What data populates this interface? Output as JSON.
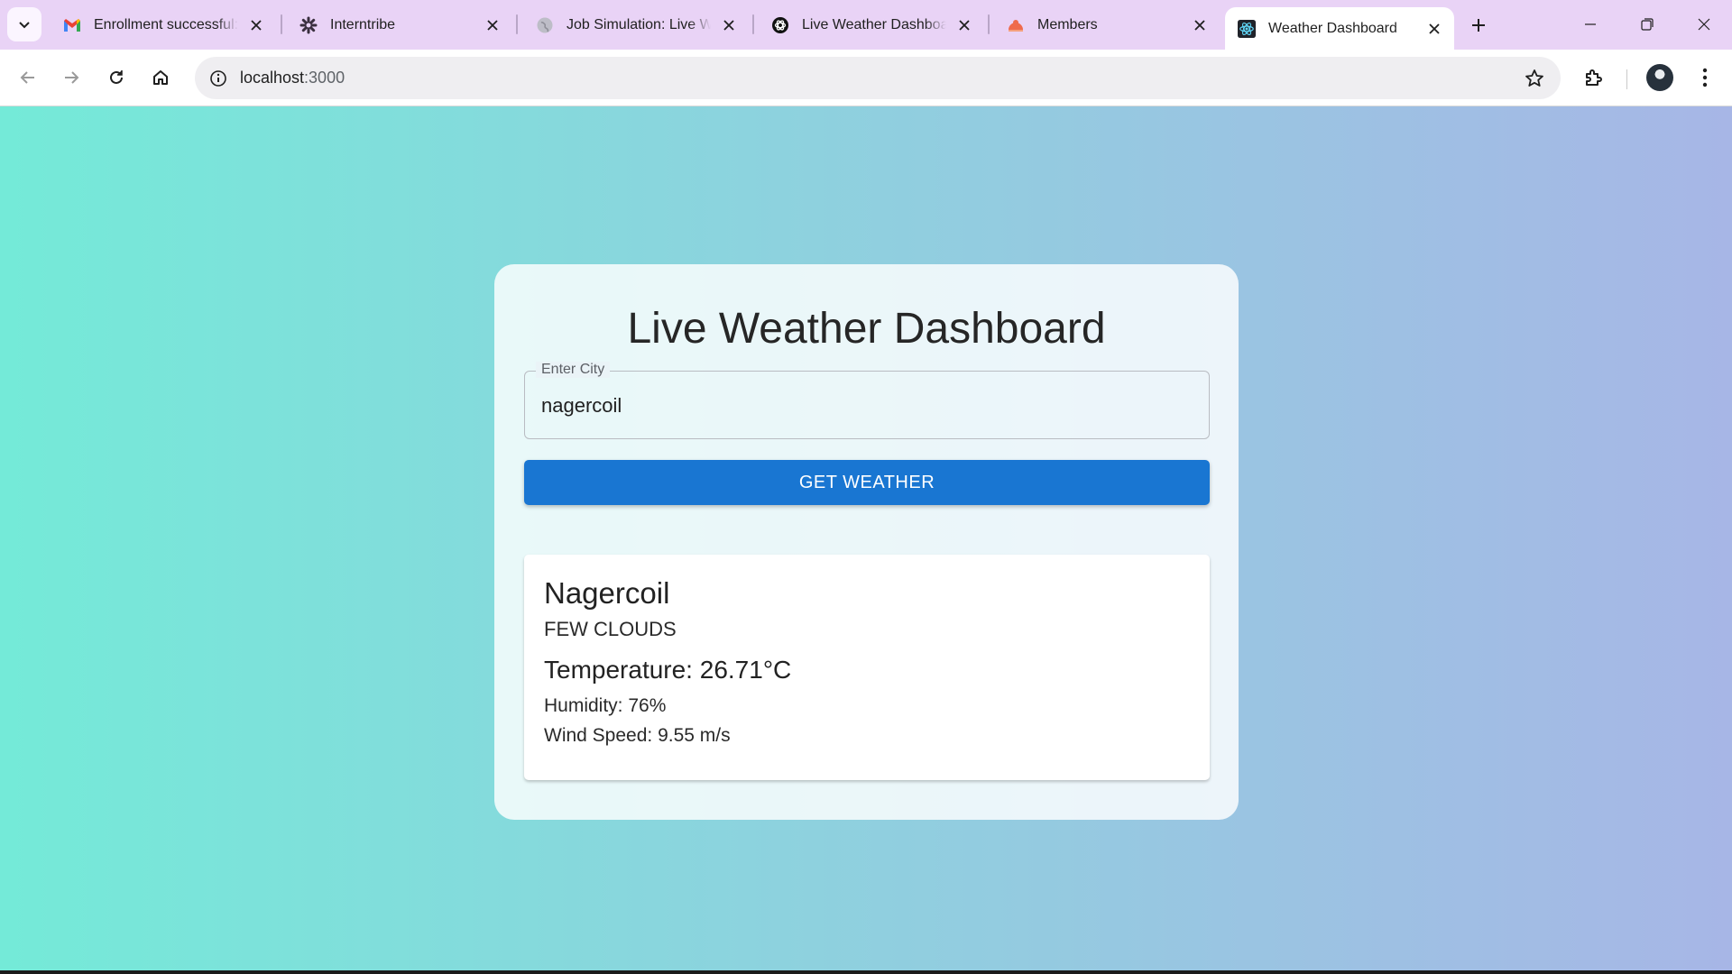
{
  "browser": {
    "tabs": [
      {
        "title": "Enrollment successful: In",
        "icon": "gmail-icon"
      },
      {
        "title": "Interntribe",
        "icon": "interntribe-icon"
      },
      {
        "title": "Job Simulation: Live Wea",
        "icon": "globe-icon"
      },
      {
        "title": "Live Weather Dashboard",
        "icon": "openai-icon"
      },
      {
        "title": "Members",
        "icon": "members-icon"
      },
      {
        "title": "Weather Dashboard",
        "icon": "react-icon",
        "active": true
      }
    ],
    "url_host": "localhost",
    "url_port": ":3000"
  },
  "page": {
    "title": "Live Weather Dashboard",
    "city_label": "Enter City",
    "city_value": "nagercoil",
    "button_label": "GET WEATHER",
    "result": {
      "city": "Nagercoil",
      "description": "FEW CLOUDS",
      "temperature": "Temperature: 26.71°C",
      "humidity": "Humidity: 76%",
      "wind": "Wind Speed: 9.55 m/s"
    }
  },
  "colors": {
    "tabstrip": "#e9d3f6",
    "button": "#1976d2",
    "gradient_left": "#74ead8",
    "gradient_right": "#a7b6e6"
  }
}
